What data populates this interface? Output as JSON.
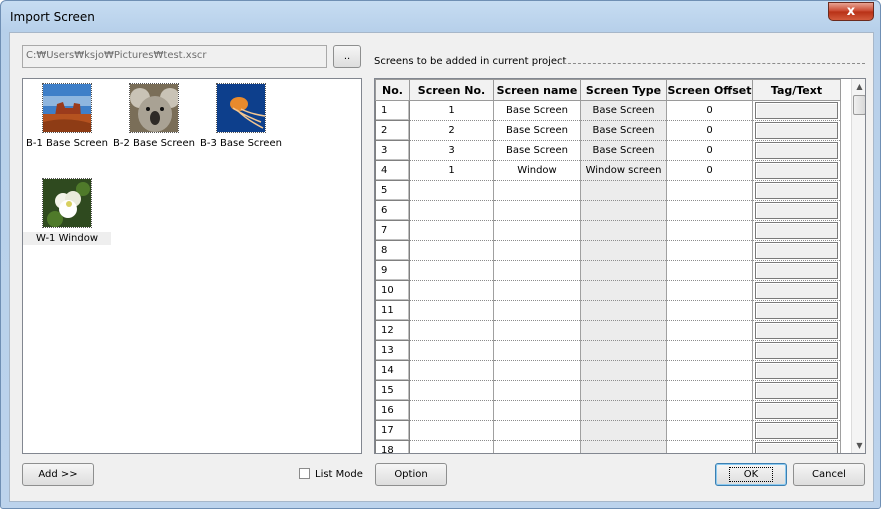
{
  "window": {
    "title": "Import Screen",
    "close_label": "x"
  },
  "file": {
    "path": "C:₩Users₩ksjo₩Pictures₩test.xscr",
    "browse_label": ".."
  },
  "thumbnails": [
    {
      "caption": "B-1 Base Screen",
      "image": "desert-rock-photo"
    },
    {
      "caption": "B-2 Base Screen",
      "image": "koala-photo"
    },
    {
      "caption": "B-3 Base Screen",
      "image": "jellyfish-photo"
    },
    {
      "caption": "W-1 Window",
      "image": "white-flower-photo"
    }
  ],
  "grid": {
    "section_label": "Screens to be added in current project",
    "headers": [
      "No.",
      "Screen No.",
      "Screen name",
      "Screen Type",
      "Screen Offset",
      "Tag/Text"
    ],
    "rows": [
      {
        "no": "1",
        "screen_no": "1",
        "name": "Base Screen",
        "type": "Base Screen",
        "offset": "0"
      },
      {
        "no": "2",
        "screen_no": "2",
        "name": "Base Screen",
        "type": "Base Screen",
        "offset": "0"
      },
      {
        "no": "3",
        "screen_no": "3",
        "name": "Base Screen",
        "type": "Base Screen",
        "offset": "0"
      },
      {
        "no": "4",
        "screen_no": "1",
        "name": "Window",
        "type": "Window screen",
        "offset": "0"
      },
      {
        "no": "5",
        "screen_no": "",
        "name": "",
        "type": "",
        "offset": ""
      },
      {
        "no": "6",
        "screen_no": "",
        "name": "",
        "type": "",
        "offset": ""
      },
      {
        "no": "7",
        "screen_no": "",
        "name": "",
        "type": "",
        "offset": ""
      },
      {
        "no": "8",
        "screen_no": "",
        "name": "",
        "type": "",
        "offset": ""
      },
      {
        "no": "9",
        "screen_no": "",
        "name": "",
        "type": "",
        "offset": ""
      },
      {
        "no": "10",
        "screen_no": "",
        "name": "",
        "type": "",
        "offset": ""
      },
      {
        "no": "11",
        "screen_no": "",
        "name": "",
        "type": "",
        "offset": ""
      },
      {
        "no": "12",
        "screen_no": "",
        "name": "",
        "type": "",
        "offset": ""
      },
      {
        "no": "13",
        "screen_no": "",
        "name": "",
        "type": "",
        "offset": ""
      },
      {
        "no": "14",
        "screen_no": "",
        "name": "",
        "type": "",
        "offset": ""
      },
      {
        "no": "15",
        "screen_no": "",
        "name": "",
        "type": "",
        "offset": ""
      },
      {
        "no": "16",
        "screen_no": "",
        "name": "",
        "type": "",
        "offset": ""
      },
      {
        "no": "17",
        "screen_no": "",
        "name": "",
        "type": "",
        "offset": ""
      },
      {
        "no": "18",
        "screen_no": "",
        "name": "",
        "type": "",
        "offset": ""
      }
    ]
  },
  "footer": {
    "add_label": "Add  >>",
    "list_mode_label": "List Mode",
    "list_mode_checked": false,
    "option_label": "Option",
    "ok_label": "OK",
    "cancel_label": "Cancel"
  },
  "colors": {
    "title_gradient": "#c6dcf2",
    "close_button": "#c8442b",
    "screen_type_cell": "#ececec"
  }
}
